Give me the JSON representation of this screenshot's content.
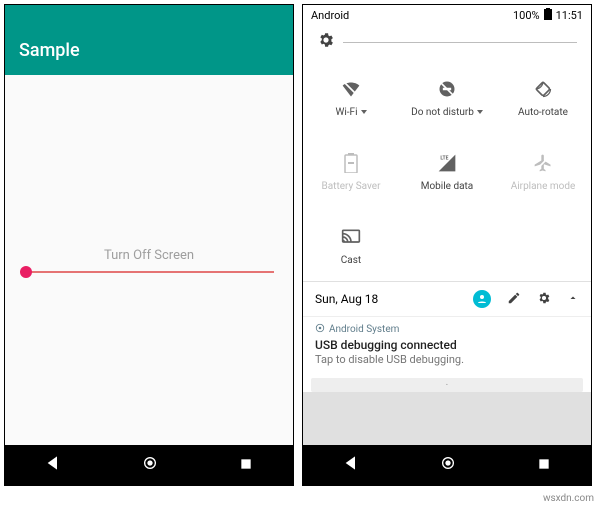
{
  "left": {
    "appbar_title": "Sample",
    "button_label": "Turn Off Screen"
  },
  "right": {
    "status": {
      "carrier": "Android",
      "battery_pct": "100%",
      "time": "11:51"
    },
    "tiles": [
      {
        "label": "Wi-Fi",
        "icon": "wifi-off-icon",
        "has_caret": true,
        "disabled": false
      },
      {
        "label": "Do not disturb",
        "icon": "dnd-icon",
        "has_caret": true,
        "disabled": false
      },
      {
        "label": "Auto-rotate",
        "icon": "rotate-icon",
        "has_caret": false,
        "disabled": false
      },
      {
        "label": "Battery Saver",
        "icon": "battery-icon",
        "has_caret": false,
        "disabled": true
      },
      {
        "label": "Mobile data",
        "icon": "lte-icon",
        "has_caret": false,
        "disabled": false
      },
      {
        "label": "Airplane mode",
        "icon": "airplane-icon",
        "has_caret": false,
        "disabled": true
      },
      {
        "label": "Cast",
        "icon": "cast-icon",
        "has_caret": false,
        "disabled": false
      }
    ],
    "footer_date": "Sun, Aug 18",
    "notification": {
      "app": "Android System",
      "title": "USB debugging connected",
      "body": "Tap to disable USB debugging."
    }
  },
  "watermark": "wsxdn.com"
}
